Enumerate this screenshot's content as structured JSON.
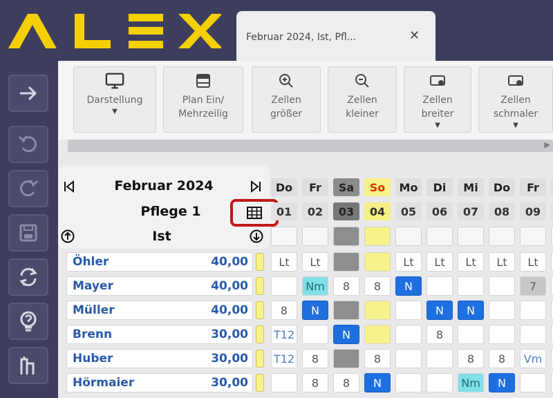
{
  "app": {
    "logo_text": "ALEX",
    "tab_label": "Februar 2024, Ist, Pfl...",
    "tab_close": "✕"
  },
  "colors": {
    "brand_yellow": "#f4d000",
    "chrome": "#3d3e5e",
    "highlight_red": "#c01818",
    "night_blue": "#1e6fe0",
    "nm_cyan": "#7fe0e8",
    "sunday_yellow": "#f7f28a",
    "saturday_grey": "#8c8c8c"
  },
  "sidebar": {
    "items": [
      {
        "icon": "arrow-right-icon"
      },
      {
        "icon": "undo-icon"
      },
      {
        "icon": "redo-icon"
      },
      {
        "icon": "save-icon"
      },
      {
        "icon": "refresh-icon"
      },
      {
        "icon": "help-bulb-icon"
      },
      {
        "icon": "logo-m-icon"
      }
    ]
  },
  "toolbar": {
    "buttons": [
      {
        "label": "Darstellung",
        "icon": "monitor-icon",
        "has_dropdown": true
      },
      {
        "label": "Plan Ein/\nMehrzeilig",
        "icon": "rows-icon",
        "has_dropdown": false
      },
      {
        "label": "Zellen\ngrößer",
        "icon": "zoom-in-icon",
        "has_dropdown": false
      },
      {
        "label": "Zellen\nkleiner",
        "icon": "zoom-out-icon",
        "has_dropdown": false
      },
      {
        "label": "Zellen\nbreiter",
        "icon": "widen-icon",
        "has_dropdown": true
      },
      {
        "label": "Zellen\nschmaler",
        "icon": "narrow-icon",
        "has_dropdown": true
      }
    ]
  },
  "info_panel": {
    "month": "Februar 2024",
    "unit": "Pflege 1",
    "mode": "Ist"
  },
  "calendar": {
    "days": [
      {
        "dow": "Do",
        "date": "01",
        "type": "normal"
      },
      {
        "dow": "Fr",
        "date": "02",
        "type": "normal"
      },
      {
        "dow": "Sa",
        "date": "03",
        "type": "saturday"
      },
      {
        "dow": "So",
        "date": "04",
        "type": "sunday"
      },
      {
        "dow": "Mo",
        "date": "05",
        "type": "normal"
      },
      {
        "dow": "Di",
        "date": "06",
        "type": "normal"
      },
      {
        "dow": "Mi",
        "date": "07",
        "type": "normal"
      },
      {
        "dow": "Do",
        "date": "08",
        "type": "normal"
      },
      {
        "dow": "Fr",
        "date": "09",
        "type": "normal"
      },
      {
        "dow": "",
        "date": "",
        "type": "normal"
      }
    ],
    "employees": [
      {
        "name": "Öhler",
        "hours": "40,00",
        "cells": [
          "Lt",
          "Lt",
          "",
          "",
          "Lt",
          "Lt",
          "Lt",
          "Lt",
          "Lt",
          ""
        ]
      },
      {
        "name": "Mayer",
        "hours": "40,00",
        "cells": [
          "",
          "Nm",
          "8",
          "8",
          "N",
          "",
          "",
          "",
          "7",
          ""
        ]
      },
      {
        "name": "Müller",
        "hours": "40,00",
        "cells": [
          "8",
          "N",
          "",
          "",
          "",
          "N",
          "N",
          "",
          "",
          ""
        ]
      },
      {
        "name": "Brenn",
        "hours": "30,00",
        "cells": [
          "T12",
          "",
          "N",
          "",
          "",
          "8",
          "",
          "",
          "",
          ""
        ]
      },
      {
        "name": "Huber",
        "hours": "30,00",
        "cells": [
          "T12",
          "8",
          "",
          "8",
          "",
          "",
          "8",
          "8",
          "Vm",
          ""
        ]
      },
      {
        "name": "Hörmaier",
        "hours": "30,00",
        "cells": [
          "",
          "8",
          "8",
          "N",
          "",
          "",
          "Nm",
          "N",
          "",
          ""
        ]
      }
    ]
  }
}
